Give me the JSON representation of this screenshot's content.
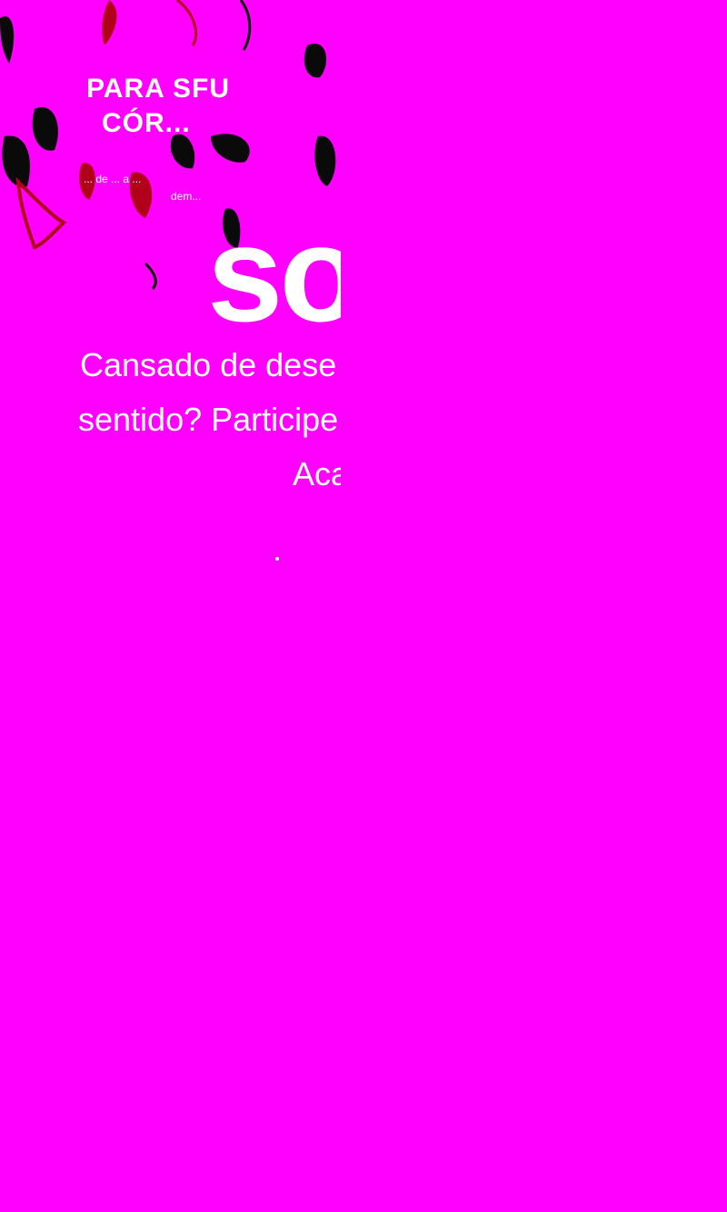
{
  "colors": {
    "background": "#ff00ff",
    "text": "#ffffff",
    "art_dark": "#0a0a0a",
    "art_red": "#b0001a"
  },
  "hero": {
    "title_line1": "PARA SFU",
    "title_line2": "CÓR...",
    "subtitle_line1": "... de ... a ...",
    "subtitle_line2": "dem...",
    "big_word": "sor"
  },
  "intro": {
    "line1": "Cansado de dese",
    "line2": "sentido? Participe",
    "line3": "Aca"
  }
}
